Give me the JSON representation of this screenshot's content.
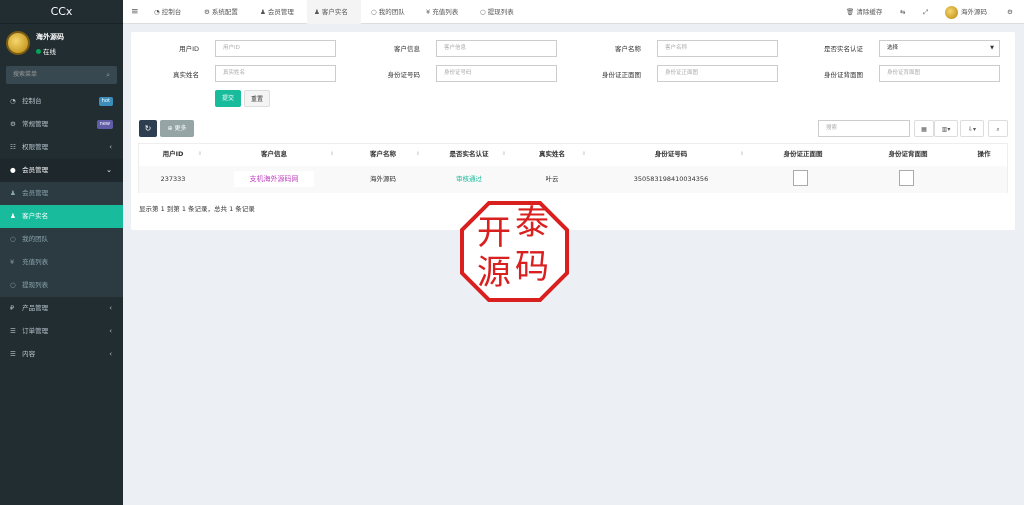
{
  "app": {
    "logo": "CCx"
  },
  "user": {
    "name": "海外源码",
    "status": "在线"
  },
  "sidebar": {
    "search_placeholder": "搜索菜单",
    "items": [
      {
        "label": "控制台",
        "icon": "dashboard-icon",
        "badge": "hot",
        "badge_color": "#3c8dbc"
      },
      {
        "label": "常规管理",
        "icon": "cogs-icon",
        "badge": "new",
        "badge_color": "#605ca8"
      },
      {
        "label": "权限管理",
        "icon": "group-icon",
        "chevron": "‹"
      },
      {
        "label": "会员管理",
        "icon": "user-circle-icon",
        "chevron": "⌄"
      }
    ],
    "sub_items": [
      {
        "label": "会员管理"
      },
      {
        "label": "客户实名"
      },
      {
        "label": "我的团队"
      },
      {
        "label": "充值列表"
      },
      {
        "label": "提现列表"
      }
    ],
    "items2": [
      {
        "label": "产品管理",
        "chevron": "‹"
      },
      {
        "label": "订单管理",
        "chevron": "‹"
      },
      {
        "label": "内容",
        "chevron": "‹"
      }
    ]
  },
  "topbar": {
    "tabs": [
      "控制台",
      "系统配置",
      "会员管理",
      "客户实名",
      "我的团队",
      "充值列表",
      "提现列表"
    ],
    "clear_cache": "清除缓存",
    "username": "海外源码"
  },
  "filters": {
    "row1": [
      {
        "label": "用户ID",
        "placeholder": "用户ID"
      },
      {
        "label": "客户信息",
        "placeholder": "客户信息"
      },
      {
        "label": "客户名称",
        "placeholder": "客户名称"
      },
      {
        "label": "是否实名认证",
        "value": "选择"
      }
    ],
    "row2": [
      {
        "label": "真实姓名",
        "placeholder": "真实姓名"
      },
      {
        "label": "身份证号码",
        "placeholder": "身份证号码"
      },
      {
        "label": "身份证正面图",
        "placeholder": "身份证正面图"
      },
      {
        "label": "身份证背面图",
        "placeholder": "身份证背面图"
      }
    ],
    "submit": "提交",
    "reset": "重置"
  },
  "toolbar": {
    "more": "更多",
    "search_placeholder": "搜索"
  },
  "table": {
    "headers": [
      "用户ID",
      "客户信息",
      "客户名称",
      "是否实名认证",
      "真实姓名",
      "身份证号码",
      "身份证正面图",
      "身份证背面图",
      "操作"
    ],
    "rows": [
      {
        "id": "237333",
        "info": "支机海外源码网",
        "name": "海外源码",
        "status": "审核通过",
        "real_name": "叶云",
        "id_number": "350583198410034356"
      }
    ],
    "status_color": "#18bc9c"
  },
  "pagination": {
    "summary": "显示第 1 到第 1 条记录，总共 1 条记录"
  },
  "watermark": {
    "text": [
      "开",
      "泰",
      "源",
      "码"
    ],
    "color": "#d9201f"
  }
}
